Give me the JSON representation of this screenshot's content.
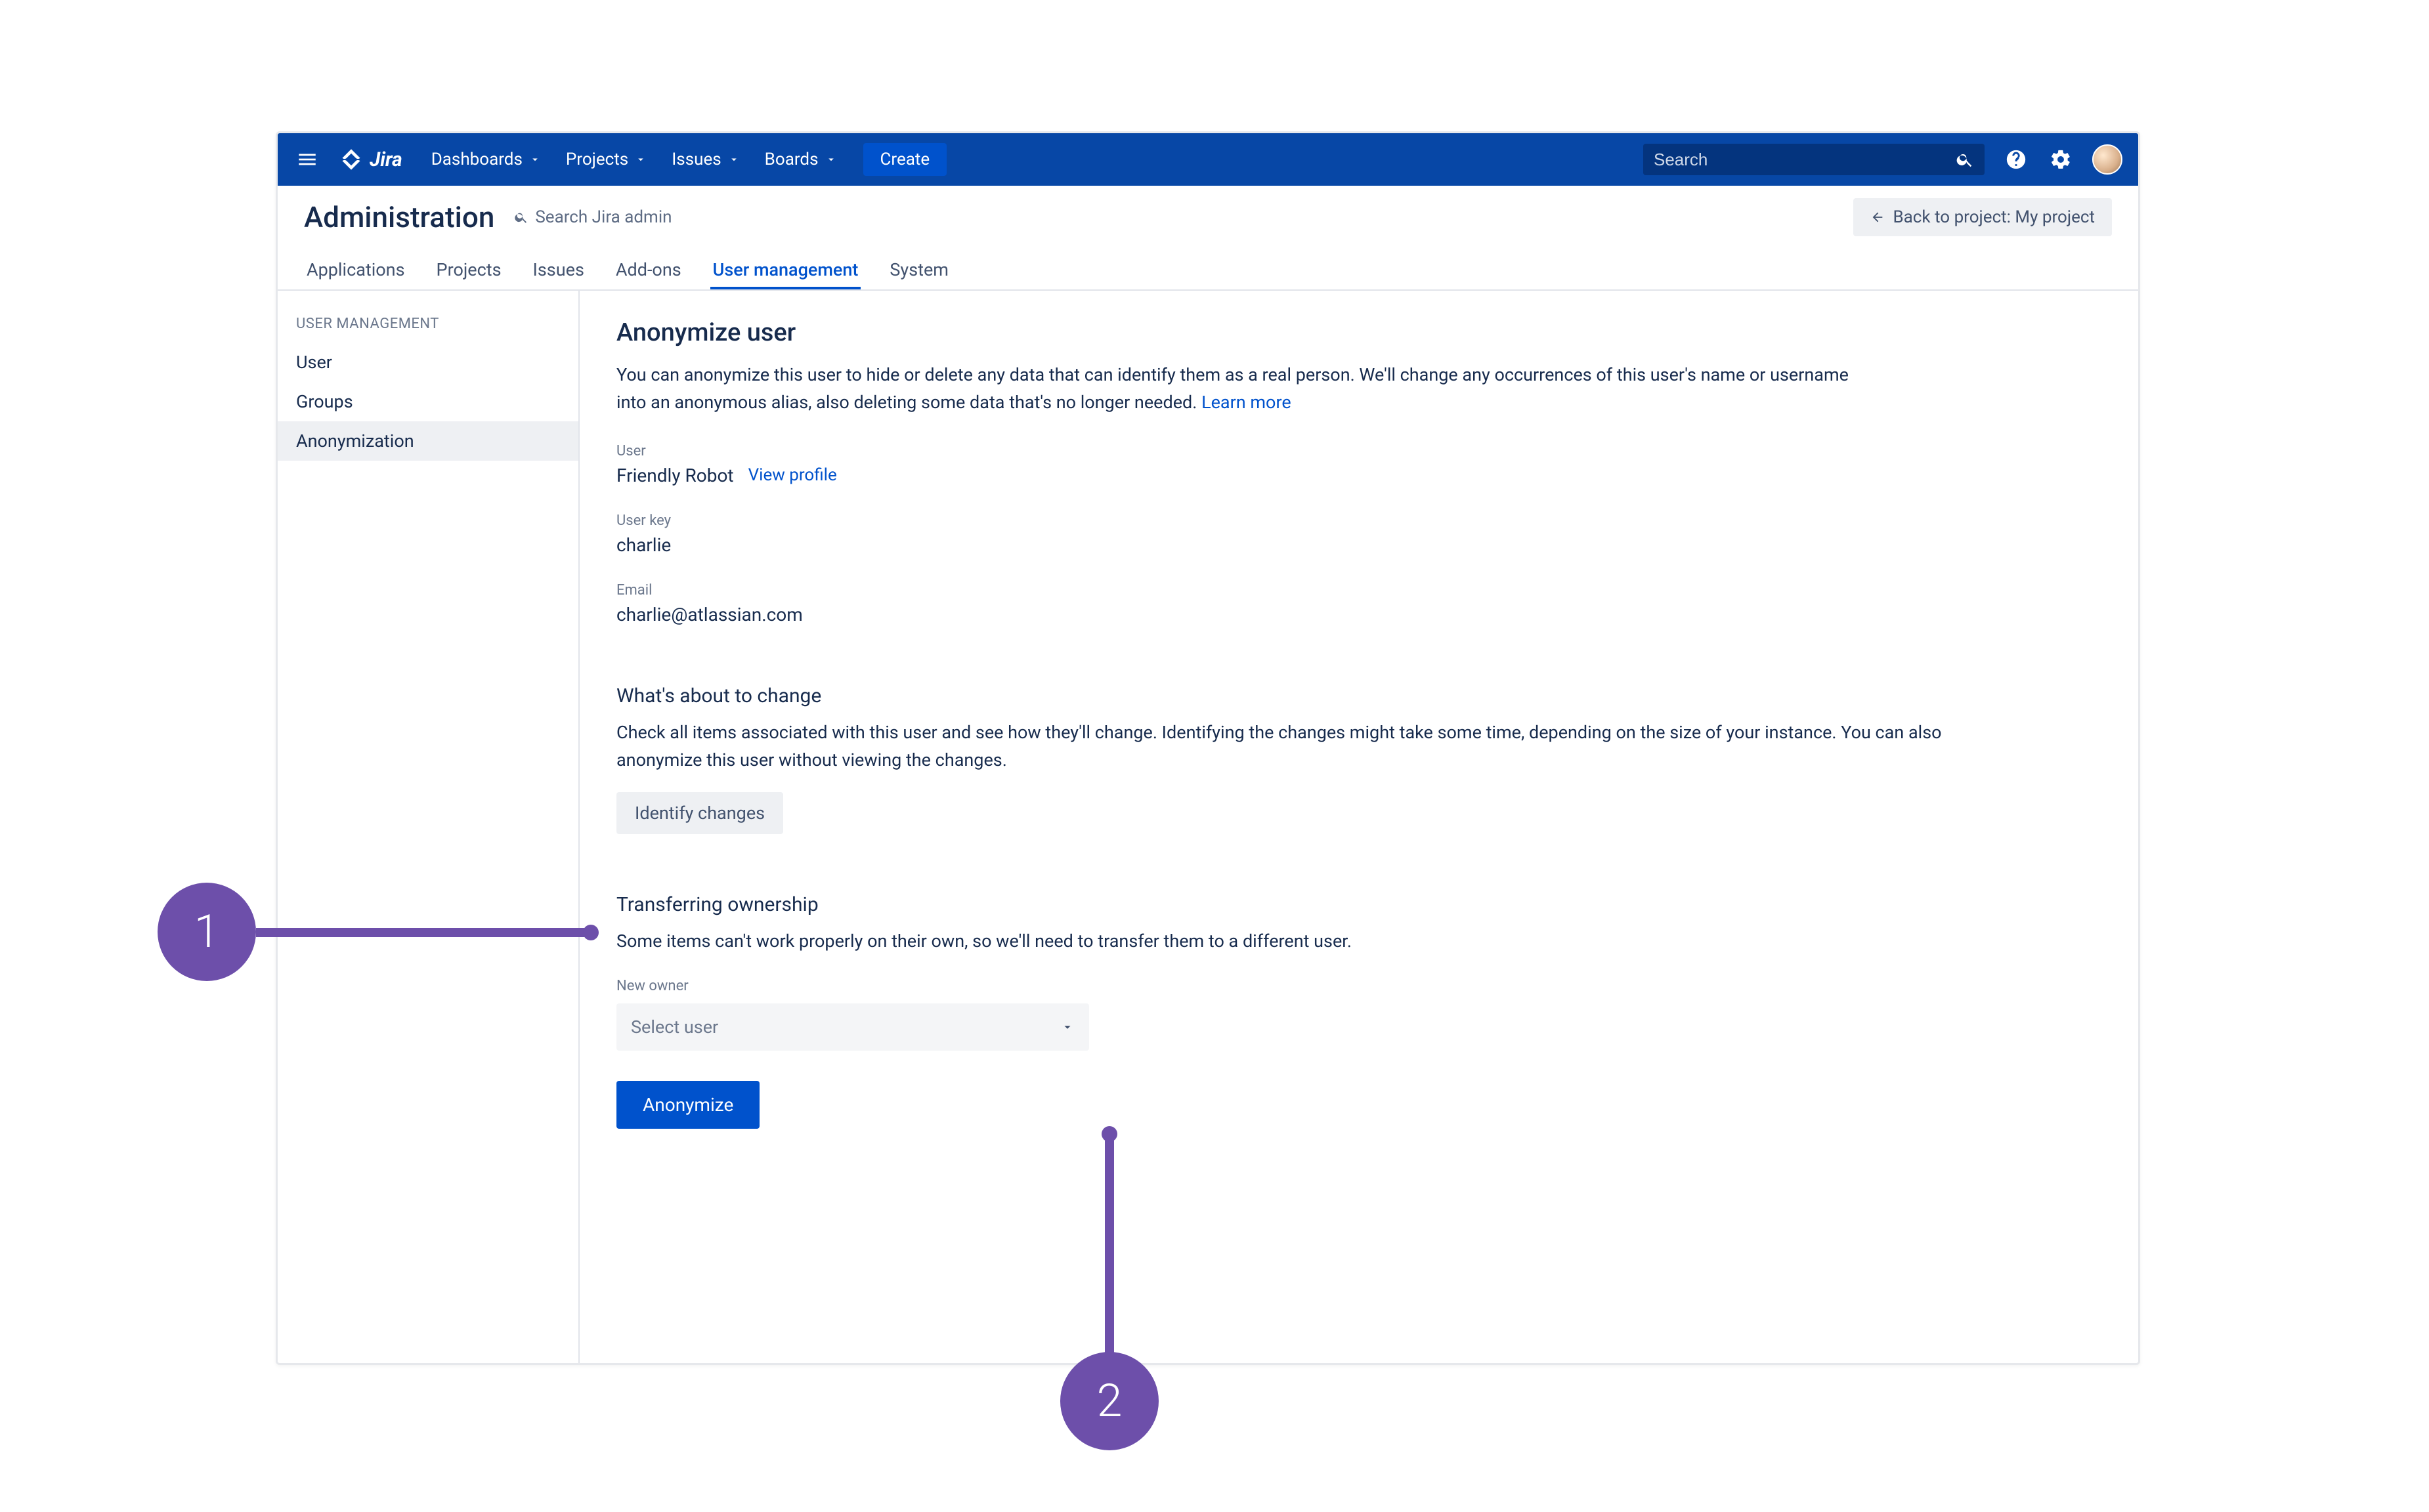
{
  "topnav": {
    "product": "Jira",
    "items": [
      "Dashboards",
      "Projects",
      "Issues",
      "Boards"
    ],
    "create": "Create",
    "search_placeholder": "Search"
  },
  "subheader": {
    "title": "Administration",
    "search_placeholder": "Search Jira admin",
    "back_label": "Back to project: My project"
  },
  "tabs": {
    "items": [
      "Applications",
      "Projects",
      "Issues",
      "Add-ons",
      "User management",
      "System"
    ],
    "active_index": 4
  },
  "sidebar": {
    "heading": "USER MANAGEMENT",
    "items": [
      "User",
      "Groups",
      "Anonymization"
    ],
    "active_index": 2
  },
  "main": {
    "title": "Anonymize user",
    "lead": "You can anonymize this user to hide or delete any data that can identify them as a real person. We'll change any occurrences of this user's name or username into an anonymous alias, also deleting some data that's no longer needed. ",
    "learn_more": "Learn more",
    "fields": {
      "user_label": "User",
      "user_value": "Friendly Robot",
      "view_profile": "View profile",
      "user_key_label": "User key",
      "user_key_value": "charlie",
      "email_label": "Email",
      "email_value": "charlie@atlassian.com"
    },
    "changes": {
      "title": "What's about to change",
      "desc": "Check all items associated with this user and see how they'll change. Identifying the changes might take some time, depending on the size of your instance. You can also anonymize this user without viewing the changes.",
      "button": "Identify changes"
    },
    "transfer": {
      "title": "Transferring ownership",
      "desc": "Some items can't work properly on their own, so we'll need to transfer them to a different user.",
      "new_owner_label": "New owner",
      "select_placeholder": "Select user"
    },
    "anonymize_button": "Anonymize"
  },
  "annotations": {
    "one": "1",
    "two": "2"
  }
}
